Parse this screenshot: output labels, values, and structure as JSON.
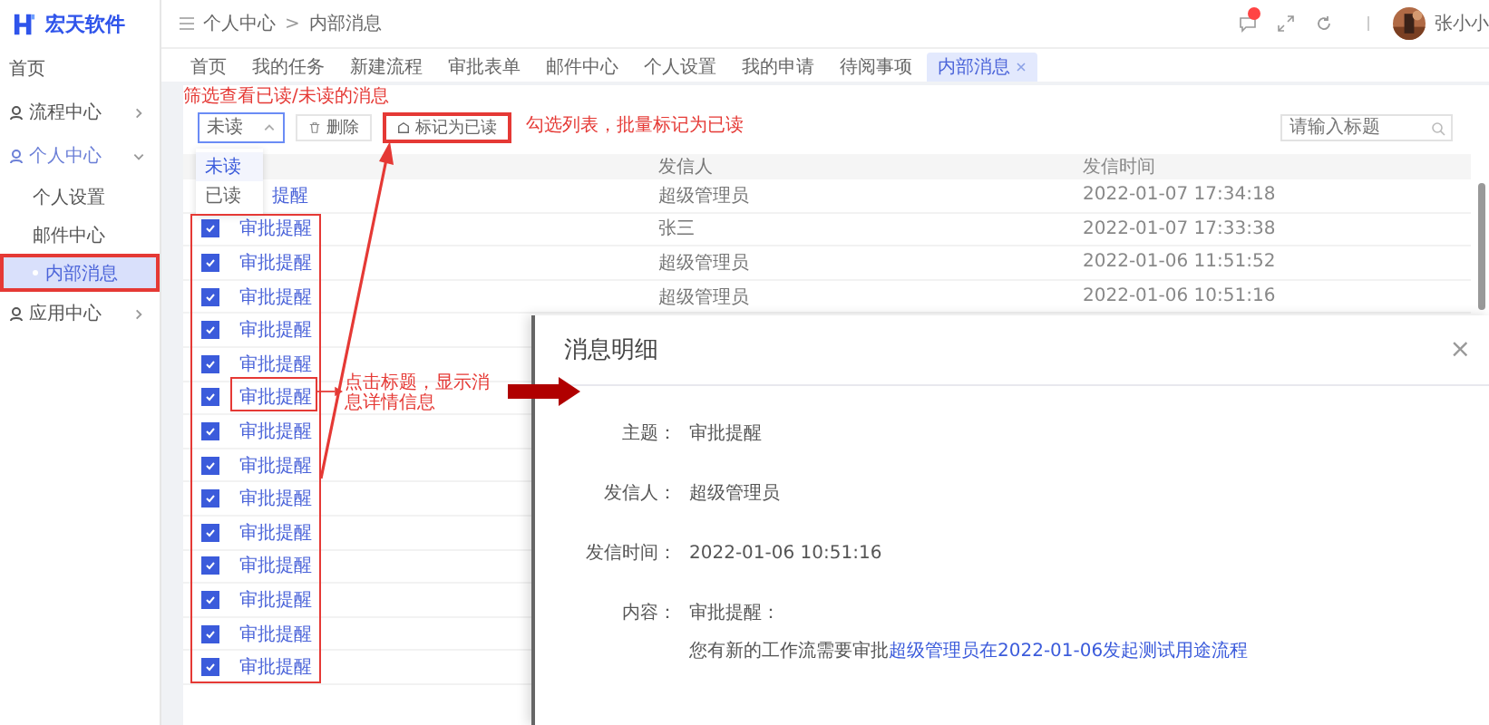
{
  "brand": {
    "name": "宏天软件"
  },
  "sidebar": {
    "items": [
      {
        "label": "首页",
        "kind": "link",
        "selected": false
      },
      {
        "label": "流程中心",
        "kind": "group",
        "expanded": false,
        "selected": false
      },
      {
        "label": "个人中心",
        "kind": "group",
        "expanded": true,
        "selected": false,
        "children": [
          {
            "label": "个人设置",
            "selected": false
          },
          {
            "label": "邮件中心",
            "selected": false
          },
          {
            "label": "内部消息",
            "selected": true
          }
        ]
      },
      {
        "label": "应用中心",
        "kind": "group",
        "expanded": false,
        "selected": false
      }
    ]
  },
  "breadcrumb": {
    "separator": ">",
    "items": [
      "个人中心",
      "内部消息"
    ]
  },
  "user": {
    "name": "张小小",
    "has_unread": true
  },
  "tabs": [
    {
      "label": "首页",
      "selected": false
    },
    {
      "label": "我的任务",
      "selected": false
    },
    {
      "label": "新建流程",
      "selected": false
    },
    {
      "label": "审批表单",
      "selected": false
    },
    {
      "label": "邮件中心",
      "selected": false
    },
    {
      "label": "个人设置",
      "selected": false
    },
    {
      "label": "我的申请",
      "selected": false
    },
    {
      "label": "待阅事项",
      "selected": false
    },
    {
      "label": "内部消息",
      "selected": true,
      "closable": true
    }
  ],
  "toolbar": {
    "filter": {
      "value": "未读",
      "expanded": true,
      "options": [
        {
          "label": "未读",
          "selected": true
        },
        {
          "label": "已读",
          "selected": false
        }
      ]
    },
    "delete_button": "删除",
    "mark_read_button": "标记为已读",
    "search": {
      "placeholder": "请输入标题"
    }
  },
  "table": {
    "columns": [
      "发信人",
      "发信时间"
    ],
    "rows": [
      {
        "title": "提醒",
        "sender": "超级管理员",
        "time": "2022-01-07 17:34:18"
      },
      {
        "title": "审批提醒",
        "checked": true,
        "sender": "张三",
        "time": "2022-01-07 17:33:38"
      },
      {
        "title": "审批提醒",
        "checked": true,
        "sender": "超级管理员",
        "time": "2022-01-06 11:51:52"
      },
      {
        "title": "审批提醒",
        "checked": true,
        "sender": "超级管理员",
        "time": "2022-01-06 10:51:16"
      },
      {
        "title": "审批提醒",
        "checked": true
      },
      {
        "title": "审批提醒",
        "checked": true
      },
      {
        "title": "审批提醒",
        "checked": true
      },
      {
        "title": "审批提醒",
        "checked": true
      },
      {
        "title": "审批提醒",
        "checked": true
      },
      {
        "title": "审批提醒",
        "checked": true
      },
      {
        "title": "审批提醒",
        "checked": true
      },
      {
        "title": "审批提醒",
        "checked": true
      },
      {
        "title": "审批提醒",
        "checked": true
      },
      {
        "title": "审批提醒",
        "checked": true
      },
      {
        "title": "审批提醒",
        "checked": true
      }
    ]
  },
  "annotations": {
    "filter_note": "筛选查看已读/未读的消息",
    "batch_note": "勾选列表，批量标记为已读",
    "click_note": "点击标题，显示消息详情信息"
  },
  "drawer": {
    "title": "消息明细",
    "close": "×",
    "fields": [
      {
        "label": "主题：",
        "value": "审批提醒"
      },
      {
        "label": "发信人：",
        "value": "超级管理员"
      },
      {
        "label": "发信时间：",
        "value": "2022-01-06 10:51:16"
      }
    ],
    "content": {
      "label": "内容：",
      "heading": "审批提醒：",
      "text": "您有新的工作流需要审批",
      "link": "超级管理员在2022-01-06发起测试用途流程"
    }
  }
}
